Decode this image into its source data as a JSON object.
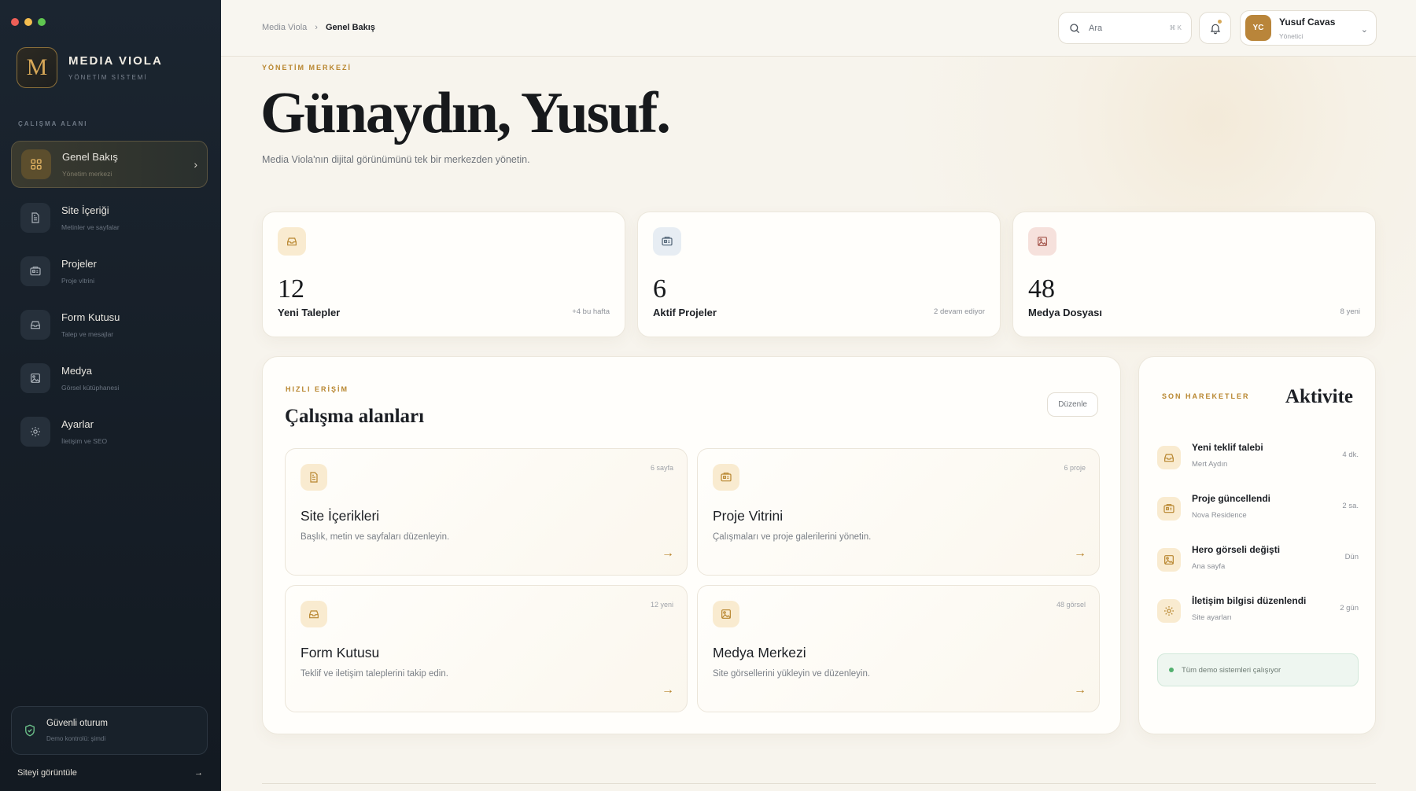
{
  "sidebar": {
    "brand": {
      "logo_letter": "M",
      "name": "MEDIA VIOLA",
      "subtitle": "YÖNETİM SİSTEMİ"
    },
    "section_label": "ÇALIŞMA ALANI",
    "items": [
      {
        "title": "Genel Bakış",
        "subtitle": "Yönetim merkezi",
        "icon": "grid-icon",
        "active": true
      },
      {
        "title": "Site İçeriği",
        "subtitle": "Metinler ve sayfalar",
        "icon": "document-icon",
        "active": false
      },
      {
        "title": "Projeler",
        "subtitle": "Proje vitrini",
        "icon": "project-icon",
        "active": false
      },
      {
        "title": "Form Kutusu",
        "subtitle": "Talep ve mesajlar",
        "icon": "inbox-icon",
        "active": false
      },
      {
        "title": "Medya",
        "subtitle": "Görsel kütüphanesi",
        "icon": "image-icon",
        "active": false
      },
      {
        "title": "Ayarlar",
        "subtitle": "İletişim ve SEO",
        "icon": "gear-icon",
        "active": false
      }
    ],
    "secure": {
      "title": "Güvenli oturum",
      "subtitle": "Demo kontrolü: şimdi"
    },
    "view_site": {
      "label": "Siteyi görüntüle",
      "arrow": "→"
    }
  },
  "topbar": {
    "breadcrumb": {
      "root": "Media Viola",
      "separator": "›",
      "current": "Genel Bakış"
    },
    "search": {
      "placeholder": "Ara",
      "shortcut": "⌘ K"
    },
    "user": {
      "initials": "YC",
      "name": "Yusuf Cavas",
      "role": "Yönetici"
    }
  },
  "hero": {
    "eyebrow": "YÖNETİM MERKEZİ",
    "greeting": "Günaydın, Yusuf.",
    "lead": "Media Viola'nın dijital görünümünü tek bir merkezden yönetin."
  },
  "stats": [
    {
      "value": "12",
      "label": "Yeni Talepler",
      "meta": "+4 bu hafta",
      "icon": "inbox-icon",
      "bg": "#f9ebd0",
      "fg": "#b8862f"
    },
    {
      "value": "6",
      "label": "Aktif Projeler",
      "meta": "2 devam ediyor",
      "icon": "project-icon",
      "bg": "#e7edf3",
      "fg": "#4f6274"
    },
    {
      "value": "48",
      "label": "Medya Dosyası",
      "meta": "8 yeni",
      "icon": "image-icon",
      "bg": "#f6e1dc",
      "fg": "#a4544a"
    }
  ],
  "quick_access": {
    "eyebrow": "HIZLI ERİŞİM",
    "title": "Çalışma alanları",
    "edit_label": "Düzenle",
    "tiles": [
      {
        "title": "Site İçerikleri",
        "desc": "Başlık, metin ve sayfaları düzenleyin.",
        "meta": "6 sayfa",
        "icon": "document-icon",
        "arrow": "→"
      },
      {
        "title": "Proje Vitrini",
        "desc": "Çalışmaları ve proje galerilerini yönetin.",
        "meta": "6 proje",
        "icon": "project-icon",
        "arrow": "→"
      },
      {
        "title": "Form Kutusu",
        "desc": "Teklif ve iletişim taleplerini takip edin.",
        "meta": "12 yeni",
        "icon": "inbox-icon",
        "arrow": "→"
      },
      {
        "title": "Medya Merkezi",
        "desc": "Site görsellerini yükleyin ve düzenleyin.",
        "meta": "48 görsel",
        "icon": "image-icon",
        "arrow": "→"
      }
    ]
  },
  "activity": {
    "eyebrow": "SON HAREKETLER",
    "title": "Aktivite",
    "items": [
      {
        "text": "Yeni teklif talebi",
        "sub": "Mert Aydın",
        "time": "4 dk.",
        "icon": "inbox-icon"
      },
      {
        "text": "Proje güncellendi",
        "sub": "Nova Residence",
        "time": "2 sa.",
        "icon": "project-icon"
      },
      {
        "text": "Hero görseli değişti",
        "sub": "Ana sayfa",
        "time": "Dün",
        "icon": "image-icon"
      },
      {
        "text": "İletişim bilgisi düzenlendi",
        "sub": "Site ayarları",
        "time": "2 gün",
        "icon": "gear-icon"
      }
    ],
    "status": "Tüm demo sistemleri çalışıyor"
  },
  "colors": {
    "accent": "#b8862f",
    "sidebar_bg": "#161e27",
    "page_bg": "#f6f3ec",
    "success": "#53b06f"
  }
}
